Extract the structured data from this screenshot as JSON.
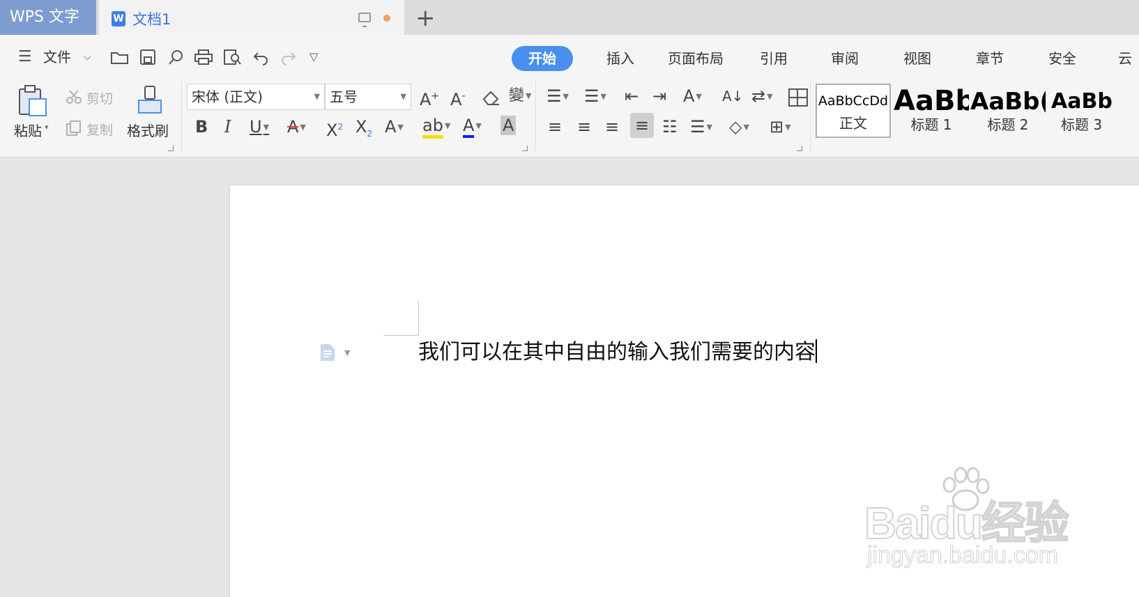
{
  "tabbar": {
    "app_name": "WPS 文字",
    "document_tab": "文档1",
    "doc_icon_letter": "W",
    "new_tab": "+"
  },
  "menu": {
    "hamburger": "☰",
    "file": "文件",
    "tabs": [
      "开始",
      "插入",
      "页面布局",
      "引用",
      "审阅",
      "视图",
      "章节",
      "安全",
      "云"
    ],
    "active_tab": "开始"
  },
  "clipboard": {
    "paste": "粘贴",
    "cut": "剪切",
    "copy": "复制",
    "format_painter": "格式刷"
  },
  "font": {
    "family": "宋体 (正文)",
    "size": "五号"
  },
  "styles": [
    {
      "preview": "AaBbCcDd",
      "name": "正文"
    },
    {
      "preview": "AaBb",
      "name": "标题 1"
    },
    {
      "preview": "AaBb(",
      "name": "标题 2"
    },
    {
      "preview": "AaBb",
      "name": "标题 3"
    }
  ],
  "document": {
    "text": "我们可以在其中自由的输入我们需要的内容"
  },
  "watermark": {
    "brand": "Baidu经验",
    "url": "jingyan.baidu.com"
  },
  "colors": {
    "accent": "#4a8ff0",
    "app_tab": "#7d9cd0",
    "highlight_yellow": "#f5e000",
    "font_color_blue": "#1a1aff"
  }
}
